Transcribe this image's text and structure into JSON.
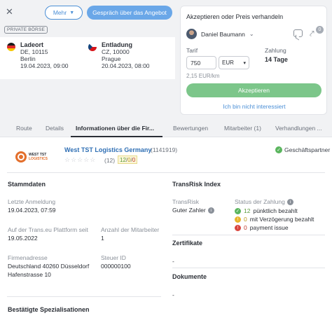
{
  "header": {
    "close_icon": "close-icon",
    "more_label": "Mehr",
    "offer_label": "Gespräch über das Angebot",
    "badge": "PRIVATE BÖRSE"
  },
  "locations": {
    "load": {
      "title": "Ladeort",
      "line1": "DE, 10115",
      "line2": "Berlin",
      "line3": "19.04.2023, 09:00"
    },
    "unload": {
      "title": "Entladung",
      "line1": "CZ, 10000",
      "line2": "Prague",
      "line3": "20.04.2023, 08:00"
    }
  },
  "offer_panel": {
    "title": "Akzeptieren oder Preis verhandeln",
    "user": "Daniel Baumann",
    "share_count": "0",
    "tarif_label": "Tarif",
    "price_value": "750",
    "currency": "EUR",
    "per_km": "2,15 EUR/km",
    "payment_label": "Zahlung",
    "payment_value": "14 Tage",
    "accept_label": "Akzeptieren",
    "not_interested": "Ich bin nicht interessiert"
  },
  "tabs": [
    {
      "label": "Route"
    },
    {
      "label": "Details"
    },
    {
      "label": "Informationen über die Fir..."
    },
    {
      "label": "Bewertungen"
    },
    {
      "label": "Mitarbeiter (1)"
    },
    {
      "label": "Verhandlungen ..."
    }
  ],
  "company": {
    "logo_line1": "WEST TST",
    "logo_line2": "LOGISTICS",
    "name": "West TST Logistics Germany",
    "id": "(1141919)",
    "stars": "☆☆☆☆☆",
    "rating_count": "(12)",
    "rating_good": "12",
    "rating_mid": "0",
    "rating_bad": "0",
    "rating_sep": "/",
    "partner_label": "Geschäftspartner"
  },
  "stammdaten": {
    "title": "Stammdaten",
    "last_login_label": "Letzte Anmeldung",
    "last_login_value": "19.04.2023, 07:59",
    "platform_label": "Auf der Trans.eu Plattform seit",
    "platform_value": "19.05.2022",
    "employees_label": "Anzahl der Mitarbeiter",
    "employees_value": "1",
    "address_label": "Firmenadresse",
    "address_line1": "Deutschland 40260 Düsseldorf",
    "address_line2": "Hafenstrasse 10",
    "tax_label": "Steuer ID",
    "tax_value": "000000100"
  },
  "transrisk": {
    "title": "TransRisk Index",
    "label": "TransRisk",
    "value": "Guter Zahler",
    "status_label": "Status der Zahlung",
    "on_time_count": "12",
    "on_time_text": "pünktlich bezahlt",
    "delayed_count": "0",
    "delayed_text": "mit Verzögerung bezahlt",
    "issue_count": "0",
    "issue_text": "payment issue"
  },
  "zertifikate": {
    "title": "Zertifikate",
    "value": "-"
  },
  "dokumente": {
    "title": "Dokumente",
    "value": "-"
  },
  "spezialisationen": {
    "title": "Bestätigte Spezialisationen"
  }
}
